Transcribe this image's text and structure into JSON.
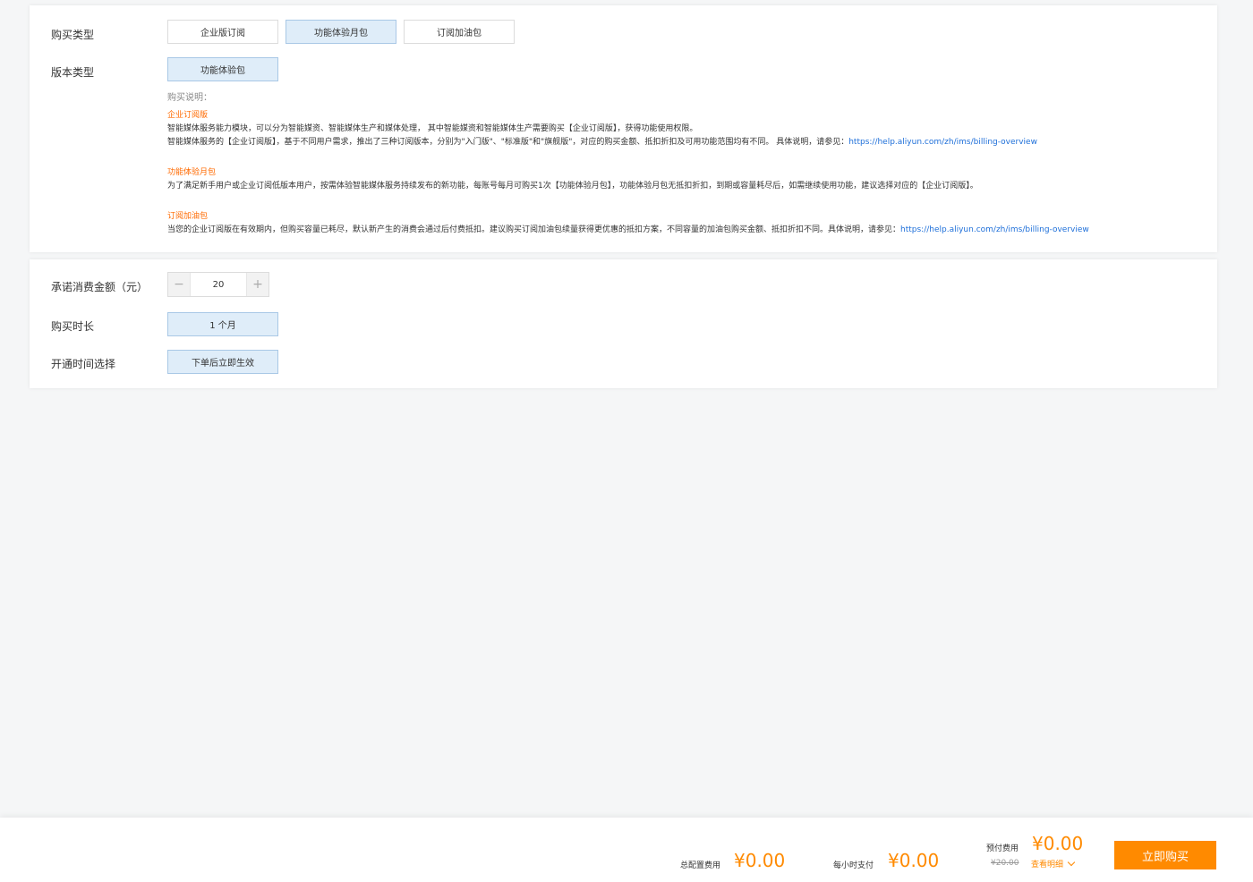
{
  "section1": {
    "purchase_type": {
      "label": "购买类型",
      "options": [
        "企业版订阅",
        "功能体验月包",
        "订阅加油包"
      ],
      "selected": "功能体验月包"
    },
    "edition_type": {
      "label": "版本类型",
      "options": [
        "功能体验包"
      ],
      "selected": "功能体验包"
    },
    "instructions": {
      "title": "购买说明：",
      "blocks": [
        {
          "heading": "企业订阅版",
          "lines": [
            "智能媒体服务能力模块，可以分为智能媒资、智能媒体生产和媒体处理， 其中智能媒资和智能媒体生产需要购买【企业订阅版】，获得功能使用权限。",
            "智能媒体服务的【企业订阅版】，基于不同用户需求，推出了三种订阅版本，分别为\"入门版\"、\"标准版\"和\"旗舰版\"，对应的购买金额、抵扣折扣及可用功能范围均有不同。 具体说明，请参见："
          ],
          "link": "https://help.aliyun.com/zh/ims/billing-overview"
        },
        {
          "heading": "功能体验月包",
          "lines": [
            "为了满足新手用户或企业订阅低版本用户，按需体验智能媒体服务持续发布的新功能，每账号每月可购买1次【功能体验月包】，功能体验月包无抵扣折扣，到期或容量耗尽后，如需继续使用功能，建议选择对应的【企业订阅版】。"
          ]
        },
        {
          "heading": "订阅加油包",
          "lines": [
            "当您的企业订阅版在有效期内，但购买容量已耗尽，默认新产生的消费会通过后付费抵扣。建议购买订阅加油包续量获得更优惠的抵扣方案，不同容量的加油包购买金额、抵扣折扣不同。具体说明，请参见："
          ],
          "link": "https://help.aliyun.com/zh/ims/billing-overview"
        }
      ]
    }
  },
  "section2": {
    "amount": {
      "label": "承诺消费金额（元）",
      "value": "20",
      "minus": "−",
      "plus": "+"
    },
    "duration": {
      "label": "购买时长",
      "selected": "1 个月"
    },
    "start_time": {
      "label": "开通时间选择",
      "selected": "下单后立即生效"
    }
  },
  "footer": {
    "total_label": "总配置费用",
    "total_value": "¥0.00",
    "hourly_label": "每小时支付",
    "hourly_value": "¥0.00",
    "prepaid_label": "预付费用",
    "prepaid_value": "¥0.00",
    "original_price": "¥20.00",
    "detail_link": "查看明细",
    "buy_button": "立即购买"
  },
  "colors": {
    "accent": "#ff8a00",
    "heading_orange": "#ff6a00",
    "link_blue": "#1e6fd9",
    "selected_bg": "#dfedf9"
  }
}
